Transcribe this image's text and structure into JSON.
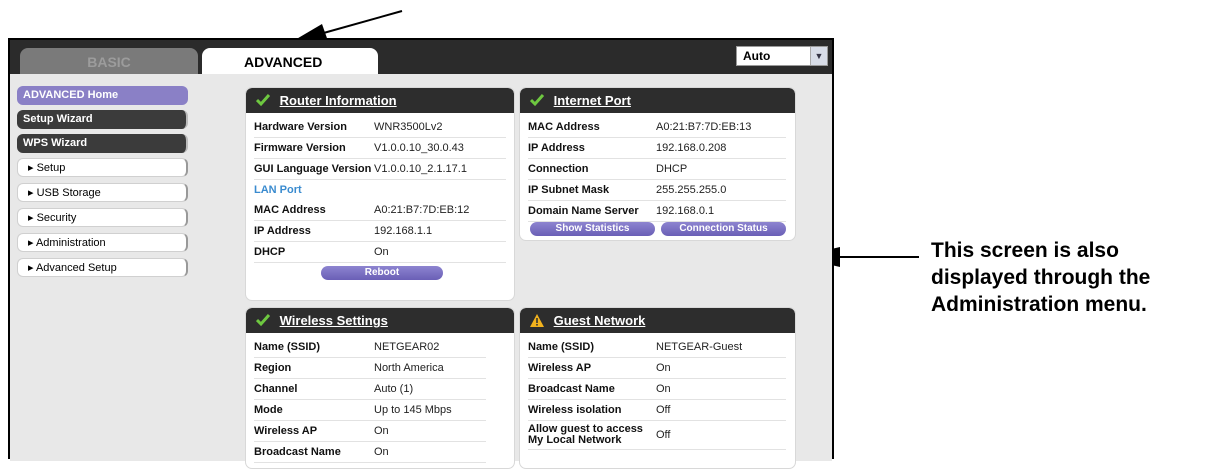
{
  "tabs": {
    "basic": "BASIC",
    "advanced": "ADVANCED"
  },
  "language_select": {
    "value": "Auto"
  },
  "sidebar": [
    {
      "label": "ADVANCED Home",
      "style": "purple"
    },
    {
      "label": "Setup Wizard",
      "style": "dark"
    },
    {
      "label": "WPS Wizard",
      "style": "dark"
    },
    {
      "label": "▸ Setup",
      "style": "white"
    },
    {
      "label": "▸ USB Storage",
      "style": "white"
    },
    {
      "label": "▸ Security",
      "style": "white"
    },
    {
      "label": "▸ Administration",
      "style": "white"
    },
    {
      "label": "▸ Advanced Setup",
      "style": "white"
    }
  ],
  "router_info": {
    "title": "Router Information",
    "rows": [
      [
        "Hardware Version",
        "WNR3500Lv2"
      ],
      [
        "Firmware Version",
        "V1.0.0.10_30.0.43"
      ],
      [
        "GUI Language Version",
        "V1.0.0.10_2.1.17.1"
      ],
      [
        "LAN Port",
        ""
      ],
      [
        "MAC Address",
        "A0:21:B7:7D:EB:12"
      ],
      [
        "IP Address",
        "192.168.1.1"
      ],
      [
        "DHCP",
        "On"
      ]
    ],
    "button": "Reboot"
  },
  "internet_port": {
    "title": "Internet Port",
    "rows": [
      [
        "MAC Address",
        "A0:21:B7:7D:EB:13"
      ],
      [
        "IP Address",
        "192.168.0.208"
      ],
      [
        "Connection",
        "DHCP"
      ],
      [
        "IP Subnet Mask",
        "255.255.255.0"
      ],
      [
        "Domain Name Server",
        "192.168.0.1"
      ]
    ],
    "button_stats": "Show Statistics",
    "button_status": "Connection Status"
  },
  "wireless": {
    "title": "Wireless Settings",
    "rows": [
      [
        "Name (SSID)",
        "NETGEAR02"
      ],
      [
        "Region",
        "North America"
      ],
      [
        "Channel",
        "Auto (1)"
      ],
      [
        "Mode",
        "Up to 145 Mbps"
      ],
      [
        "Wireless AP",
        "On"
      ],
      [
        "Broadcast Name",
        "On"
      ]
    ]
  },
  "guest": {
    "title": "Guest Network",
    "rows": [
      [
        "Name (SSID)",
        "NETGEAR-Guest"
      ],
      [
        "Wireless AP",
        "On"
      ],
      [
        "Broadcast Name",
        "On"
      ],
      [
        "Wireless isolation",
        "Off"
      ],
      [
        "Allow guest to access My Local Network",
        "Off"
      ]
    ]
  },
  "annotation": {
    "line1": "This screen is also",
    "line2": "displayed through the",
    "line3": "Administration menu."
  },
  "colors": {
    "accent": "#8a80c6",
    "header": "#2d2d2d",
    "check": "#6ec840",
    "warn": "#f2b21d"
  }
}
